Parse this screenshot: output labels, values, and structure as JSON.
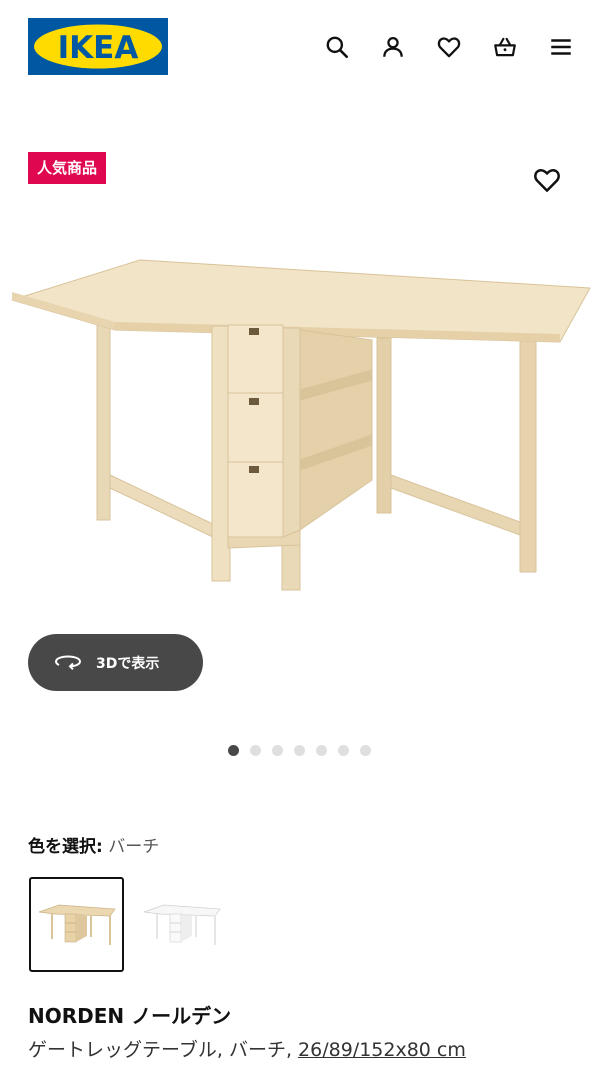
{
  "header": {
    "logo_text": "IKEA",
    "colors": {
      "logo_blue": "#0058a3",
      "logo_yellow": "#ffdb00"
    },
    "icons": [
      "search-icon",
      "account-icon",
      "heart-icon",
      "basket-icon",
      "menu-icon"
    ]
  },
  "badge": {
    "label": "人気商品",
    "color": "#e00751"
  },
  "viewer": {
    "button_label": "3Dで表示",
    "image_count": 7,
    "active_index": 0
  },
  "color_select": {
    "label": "色を選択:",
    "value": "バーチ",
    "options": [
      "birch",
      "white"
    ],
    "selected_index": 0
  },
  "product": {
    "name": "NORDEN ノールデン",
    "description": "ゲートレッグテーブル, バーチ, ",
    "size_link": "26/89/152x80 cm"
  }
}
